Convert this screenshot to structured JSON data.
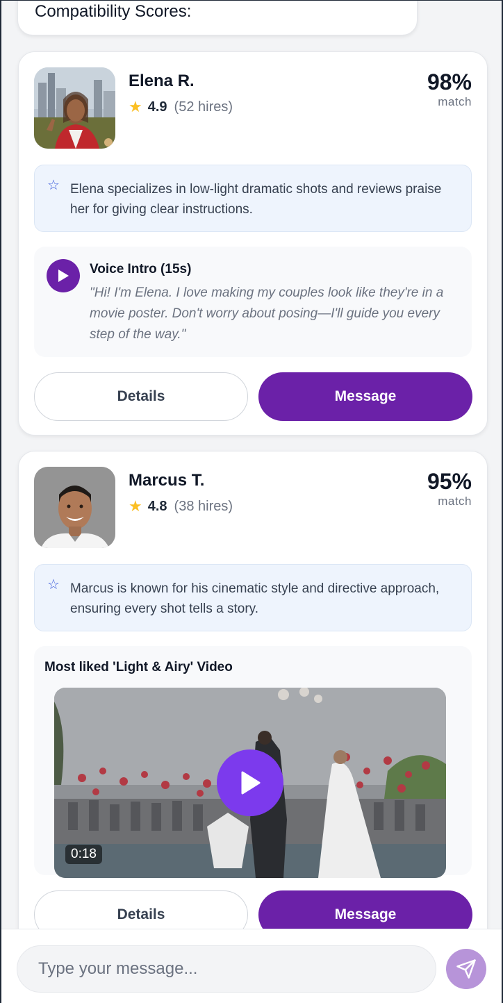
{
  "previous_card": {
    "text": "Compatibility Scores:"
  },
  "matches": [
    {
      "name": "Elena R.",
      "rating": "4.9",
      "hires": "(52 hires)",
      "match_pct": "98%",
      "match_label": "match",
      "highlight": "Elena specializes in low-light dramatic shots and reviews praise her for giving clear instructions.",
      "voice_title": "Voice Intro (15s)",
      "voice_quote": "\"Hi! I'm Elena. I love making my couples look like they're in a movie poster. Don't worry about posing—I'll guide you every step of the way.\"",
      "details_label": "Details",
      "message_label": "Message"
    },
    {
      "name": "Marcus T.",
      "rating": "4.8",
      "hires": "(38 hires)",
      "match_pct": "95%",
      "match_label": "match",
      "highlight": "Marcus is known for his cinematic style and directive approach, ensuring every shot tells a story.",
      "video_title": "Most liked 'Light & Airy' Video",
      "video_duration": "0:18",
      "details_label": "Details",
      "message_label": "Message"
    }
  ],
  "composer": {
    "placeholder": "Type your message..."
  },
  "colors": {
    "primary": "#6b21a8",
    "star": "#fbbf24",
    "highlight_bg": "#eef4fd",
    "send_button": "#b794d9"
  },
  "icons": [
    "star-icon",
    "star-outline-icon",
    "play-icon",
    "send-icon"
  ]
}
